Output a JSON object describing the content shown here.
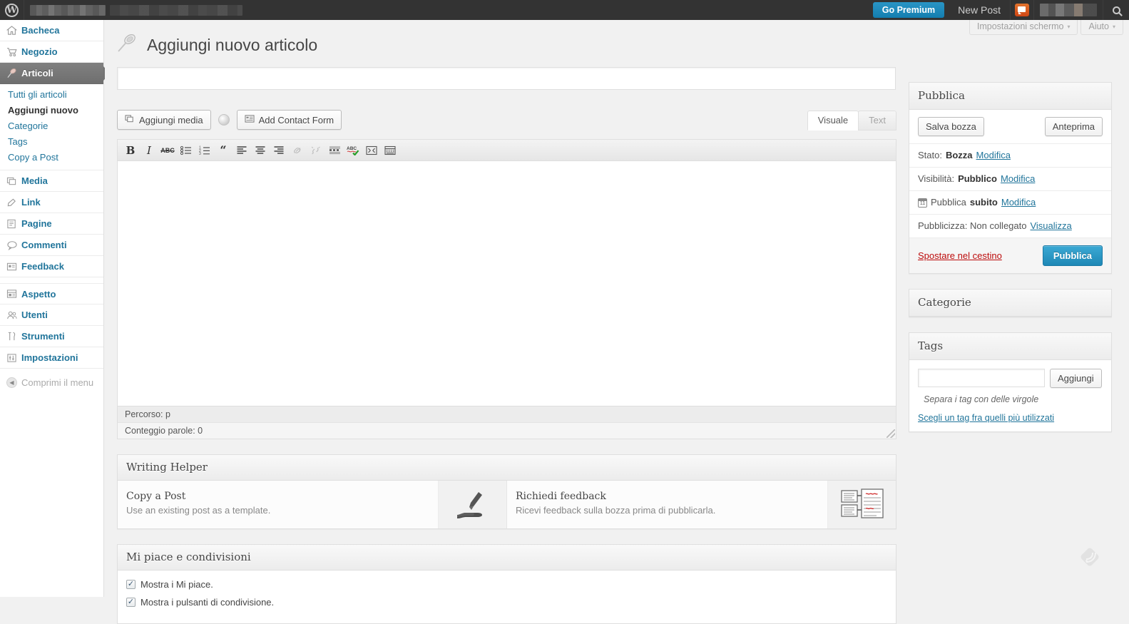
{
  "adminbar": {
    "wp_logo": "wordpress-logo",
    "site_name_blurred": "",
    "premium_label": "Go Premium",
    "new_post_label": "New Post",
    "comments_icon": "comment-bubble-icon",
    "user_blurred": "",
    "search_icon": "search-icon"
  },
  "screen_meta": {
    "screen_options_label": "Impostazioni schermo",
    "help_label": "Aiuto",
    "caret": "▾"
  },
  "sidebar": {
    "items": [
      {
        "label": "Bacheca",
        "icon": "dashboard-home-icon",
        "current": false
      },
      {
        "label": "Negozio",
        "icon": "shop-cart-icon",
        "current": false
      },
      {
        "label": "Articoli",
        "icon": "pin-icon",
        "current": true
      },
      {
        "label": "Media",
        "icon": "media-icon",
        "current": false
      },
      {
        "label": "Link",
        "icon": "link-chain-icon",
        "current": false
      },
      {
        "label": "Pagine",
        "icon": "pages-icon",
        "current": false
      },
      {
        "label": "Commenti",
        "icon": "comment-icon",
        "current": false
      },
      {
        "label": "Feedback",
        "icon": "feedback-icon",
        "current": false
      },
      {
        "label": "Aspetto",
        "icon": "appearance-icon",
        "current": false
      },
      {
        "label": "Utenti",
        "icon": "users-icon",
        "current": false
      },
      {
        "label": "Strumenti",
        "icon": "tools-icon",
        "current": false
      },
      {
        "label": "Impostazioni",
        "icon": "settings-sliders-icon",
        "current": false
      }
    ],
    "submenu": [
      {
        "label": "Tutti gli articoli",
        "current": false
      },
      {
        "label": "Aggiungi nuovo",
        "current": true
      },
      {
        "label": "Categorie",
        "current": false
      },
      {
        "label": "Tags",
        "current": false
      },
      {
        "label": "Copy a Post",
        "current": false
      }
    ],
    "collapse_label": "Comprimi il menu",
    "collapse_icon": "chevron-left-icon"
  },
  "page": {
    "title": "Aggiungi nuovo articolo",
    "title_icon": "pin-icon"
  },
  "post_title_field": {
    "value": "",
    "placeholder": ""
  },
  "editor": {
    "add_media_label": "Aggiungi media",
    "add_media_icon": "media-add-icon",
    "loader_icon": "spinner-icon",
    "add_contact_form_label": "Add Contact Form",
    "add_contact_form_icon": "contact-form-icon",
    "tabs": [
      {
        "label": "Visuale",
        "active": true
      },
      {
        "label": "Text",
        "active": false
      }
    ],
    "toolbar_buttons": [
      {
        "name": "bold-button",
        "glyph": "B",
        "style": "bold-serif",
        "dim": false
      },
      {
        "name": "italic-button",
        "glyph": "I",
        "style": "italic-serif",
        "dim": false
      },
      {
        "name": "strikethrough-button",
        "glyph": "ABC",
        "style": "strike",
        "dim": false
      },
      {
        "name": "unordered-list-button",
        "glyph": "list-ul-icon",
        "style": "svg",
        "dim": false
      },
      {
        "name": "ordered-list-button",
        "glyph": "list-ol-icon",
        "style": "svg",
        "dim": false
      },
      {
        "name": "blockquote-button",
        "glyph": "“",
        "style": "quote",
        "dim": false
      },
      {
        "name": "align-left-button",
        "glyph": "align-left-icon",
        "style": "svg",
        "dim": false
      },
      {
        "name": "align-center-button",
        "glyph": "align-center-icon",
        "style": "svg",
        "dim": false
      },
      {
        "name": "align-right-button",
        "glyph": "align-right-icon",
        "style": "svg",
        "dim": false
      },
      {
        "name": "insert-link-button",
        "glyph": "link-icon",
        "style": "svg",
        "dim": true
      },
      {
        "name": "unlink-button",
        "glyph": "unlink-icon",
        "style": "svg",
        "dim": true
      },
      {
        "name": "insert-more-tag-button",
        "glyph": "more-tag-icon",
        "style": "svg",
        "dim": false
      },
      {
        "name": "spellcheck-button",
        "glyph": "spellcheck-icon",
        "style": "svg",
        "dim": false
      },
      {
        "name": "fullscreen-button",
        "glyph": "fullscreen-icon",
        "style": "svg",
        "dim": false
      },
      {
        "name": "kitchen-sink-button",
        "glyph": "kitchen-sink-icon",
        "style": "svg",
        "dim": false
      }
    ],
    "content": "",
    "path_label": "Percorso: p",
    "word_count_label": "Conteggio parole: 0"
  },
  "writing_helper": {
    "title": "Writing Helper",
    "cards": [
      {
        "heading": "Copy a Post",
        "description": "Use an existing post as a template.",
        "icon": "hand-with-pen-icon"
      },
      {
        "heading": "Richiedi feedback",
        "description": "Ricevi feedback sulla bozza prima di pubblicarla.",
        "icon": "feedback-documents-icon"
      }
    ]
  },
  "likes_box": {
    "title": "Mi piace e condivisioni",
    "options": [
      {
        "label": "Mostra i Mi piace.",
        "checked": true
      },
      {
        "label": "Mostra i pulsanti di condivisione.",
        "checked": true
      }
    ]
  },
  "publish_box": {
    "title": "Pubblica",
    "save_draft_label": "Salva bozza",
    "preview_label": "Anteprima",
    "status_prefix": "Stato:",
    "status_value": "Bozza",
    "status_edit": "Modifica",
    "visibility_prefix": "Visibilità:",
    "visibility_value": "Pubblico",
    "visibility_edit": "Modifica",
    "schedule_icon": "calendar-icon",
    "schedule_prefix": "Pubblica",
    "schedule_value": "subito",
    "schedule_edit": "Modifica",
    "publicize_prefix": "Pubblicizza: Non collegato",
    "publicize_link": "Visualizza",
    "trash_label": "Spostare nel cestino",
    "publish_label": "Pubblica"
  },
  "categories_box": {
    "title": "Categorie"
  },
  "tags_box": {
    "title": "Tags",
    "input_value": "",
    "input_placeholder": "",
    "add_label": "Aggiungi",
    "hint": "Separa i tag con delle virgole",
    "cloud_link": "Scegli un tag fra quelli più utilizzati"
  },
  "watermark": {
    "icon": "kite-watermark-icon"
  },
  "colors": {
    "adminbar_bg": "#333333",
    "accent_blue": "#21759b",
    "button_blue": "#2ea2cc",
    "premium_blue": "#1e8cbe",
    "comment_orange": "#d54e21",
    "trash_red": "#bc0b0b",
    "sidebar_bg": "#ffffff",
    "page_bg": "#f1f1f1",
    "current_menu_bg": "#777777"
  }
}
